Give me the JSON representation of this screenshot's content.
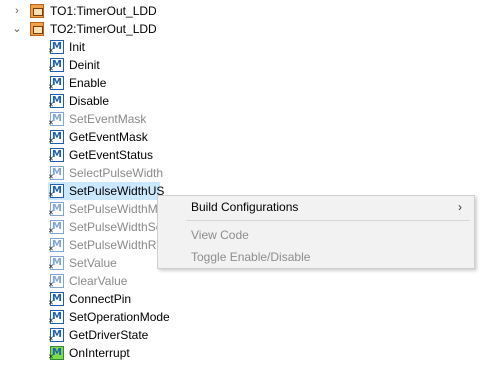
{
  "tree": {
    "to1": {
      "label": "TO1:TimerOut_LDD",
      "chevron": "›",
      "expanded": false,
      "icon": "component-icon"
    },
    "to2": {
      "label": "TO2:TimerOut_LDD",
      "chevron": "⌄",
      "expanded": true,
      "icon": "component-icon"
    },
    "methods": [
      {
        "label": "Init",
        "enabled": true
      },
      {
        "label": "Deinit",
        "enabled": true
      },
      {
        "label": "Enable",
        "enabled": true
      },
      {
        "label": "Disable",
        "enabled": true
      },
      {
        "label": "SetEventMask",
        "enabled": false
      },
      {
        "label": "GetEventMask",
        "enabled": true
      },
      {
        "label": "GetEventStatus",
        "enabled": true
      },
      {
        "label": "SelectPulseWidth",
        "enabled": false
      },
      {
        "label": "SetPulseWidthUS",
        "enabled": true,
        "selected": true
      },
      {
        "label": "SetPulseWidthM",
        "enabled": false
      },
      {
        "label": "SetPulseWidthSe",
        "enabled": false
      },
      {
        "label": "SetPulseWidthRe",
        "enabled": false
      },
      {
        "label": "SetValue",
        "enabled": false
      },
      {
        "label": "ClearValue",
        "enabled": false
      },
      {
        "label": "ConnectPin",
        "enabled": true
      },
      {
        "label": "SetOperationMode",
        "enabled": true
      },
      {
        "label": "GetDriverState",
        "enabled": true
      },
      {
        "label": "OnInterrupt",
        "enabled": true,
        "type": "event"
      }
    ]
  },
  "context_menu": {
    "items": [
      {
        "label": "Build Configurations",
        "enabled": true,
        "submenu_arrow": "›"
      },
      {
        "label": "View Code",
        "enabled": false
      },
      {
        "label": "Toggle Enable/Disable",
        "enabled": false
      }
    ]
  },
  "colors": {
    "selection": "#cce8ff",
    "method_icon": "#1d5fb0",
    "event_icon": "#7ddc4b",
    "component_icon": "#f2a24a",
    "disabled_text": "#8a8a8a"
  }
}
